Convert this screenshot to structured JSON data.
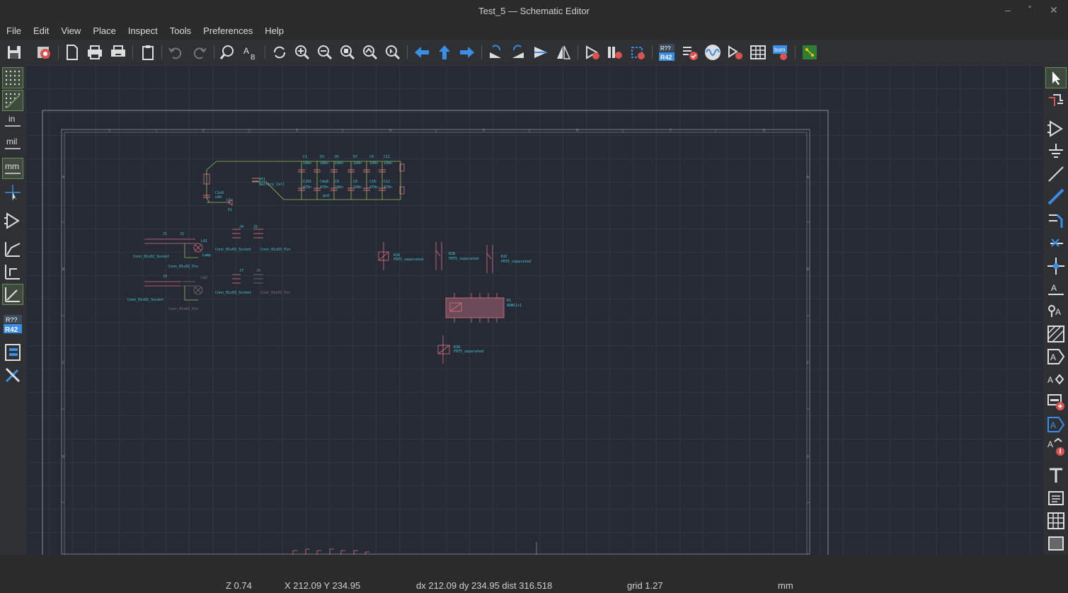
{
  "window": {
    "title": "Test_5 — Schematic Editor",
    "controls": {
      "minimize": "–",
      "maximize": "˚",
      "close": "✕"
    }
  },
  "menu": [
    "File",
    "Edit",
    "View",
    "Place",
    "Inspect",
    "Tools",
    "Preferences",
    "Help"
  ],
  "left_toolbar": {
    "unit_in": "in",
    "unit_mil": "mil",
    "unit_mm": "mm",
    "annotate_top": "R??",
    "annotate_bottom": "R42"
  },
  "toolbar": {
    "annotate_top": "R??",
    "annotate_bottom": "R42",
    "bom_label": "bom"
  },
  "status": {
    "zoom": "Z 0.74",
    "xy": "X 212.09  Y 234.95",
    "delta": "dx 212.09  dy 234.95  dist 316.518",
    "grid": "grid 1.27",
    "units": "mm"
  },
  "schematic": {
    "labels": {
      "c1": "C1",
      "d3": "D3",
      "d5": "D5",
      "d7": "D7",
      "c9": "C9",
      "c11": "C11",
      "v1": "100n",
      "v2": "100n",
      "v3": "100n",
      "v4": "100n",
      "v5": "100n",
      "v6": "100n",
      "c101": "C101",
      "c4": "C4e8",
      "c8": "C8",
      "c10": "C10",
      "c12": "C12",
      "w1": "470n",
      "w2": "470n",
      "w3": "100n",
      "w4": "100n",
      "w5": "470n",
      "w6": "470n",
      "bt1": "BT1",
      "battery": "Battery_Cell",
      "d1": "D1",
      "l6": "L6",
      "c1e": "C1e9",
      "c1ev": "u4d",
      "gnd": "gnd",
      "conn_a": "Conn_01x02_Socket",
      "conn_b": "Conn_01x02_Pin",
      "conn_c": "Conn_01x03_Socket",
      "conn_d": "Conn_01x03_Pin",
      "lamp": "Lamp",
      "la1": "LA1",
      "la2": "LA2",
      "j1": "J1",
      "j2": "J2",
      "j4": "J4",
      "j5": "J5",
      "j7": "J7",
      "j8": "J8",
      "j3": "J3",
      "k2a": "K2A",
      "k2b": "K2B",
      "k2c": "K2C",
      "k3a": "K3A",
      "rel1": "FRT5_separated",
      "rel2": "FRT5_separated",
      "rel3": "FRT5_separated",
      "rel4": "FRT5_separated",
      "k1": "K1",
      "k1v": "ADW11+1",
      "conn_e": "Conn_01x02_Socket",
      "conn_f": "Conn_01x02_Pin",
      "conn_g": "Conn_01x03_Socket",
      "conn_h": "Conn_01x03_Pin"
    }
  }
}
